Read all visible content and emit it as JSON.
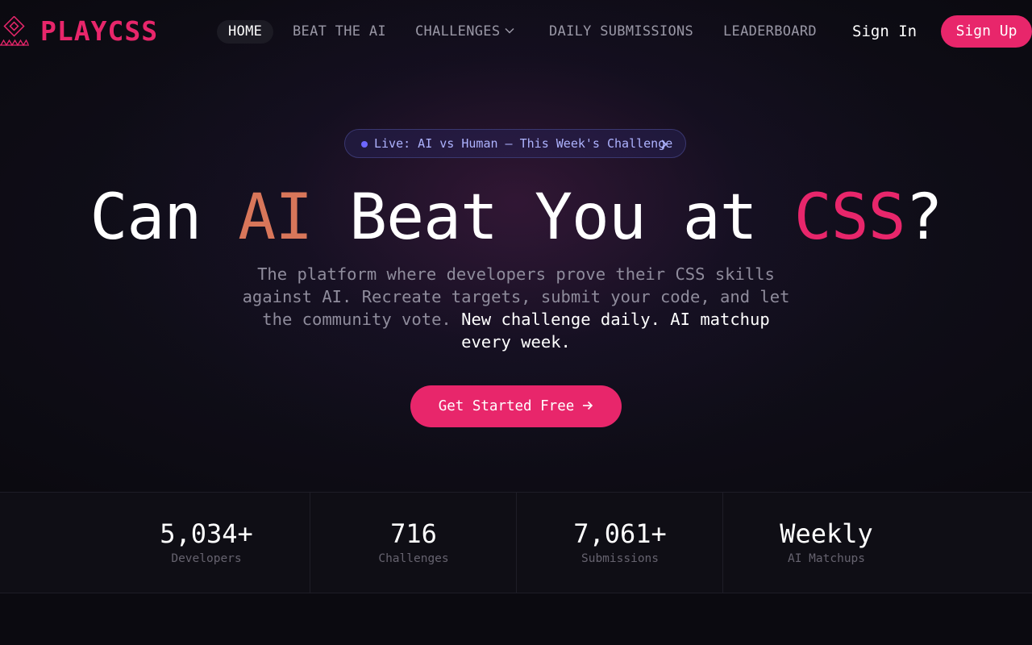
{
  "nav": {
    "logo_text": "PLAYCSS",
    "links": {
      "home": "HOME",
      "beat_ai": "BEAT THE AI",
      "challenges": "CHALLENGES",
      "daily": "DAILY SUBMISSIONS",
      "leaderboard": "LEADERBOARD"
    },
    "sign_in": "Sign In",
    "sign_up": "Sign Up"
  },
  "hero": {
    "pill": "Live: AI vs Human — This Week's Challenge",
    "headline": {
      "part1": "Can ",
      "ai": "AI",
      "part2": " Beat You at ",
      "css": "CSS",
      "part3": "?"
    },
    "sub_muted": "The platform where developers prove their CSS skills against AI. Recreate targets, submit your code, and let the community vote.",
    "sub_bright": " New challenge daily. AI matchup every week.",
    "cta": "Get Started Free"
  },
  "stats": [
    {
      "value": "5,034+",
      "label": "Developers"
    },
    {
      "value": "716",
      "label": "Challenges"
    },
    {
      "value": "7,061+",
      "label": "Submissions"
    },
    {
      "value": "Weekly",
      "label": "AI Matchups"
    }
  ],
  "colors": {
    "accent": "#e8266b",
    "ai_orange": "#d8765a",
    "pill_text": "#aeb3ff",
    "pill_dot": "#6e67ff",
    "background": "#0b0a10"
  },
  "icons": {
    "logo": "diamond-logo-icon",
    "challenges_dropdown": "chevron-down-icon",
    "pill_arrow": "chevron-right-icon",
    "cta_arrow": "arrow-right-icon"
  }
}
